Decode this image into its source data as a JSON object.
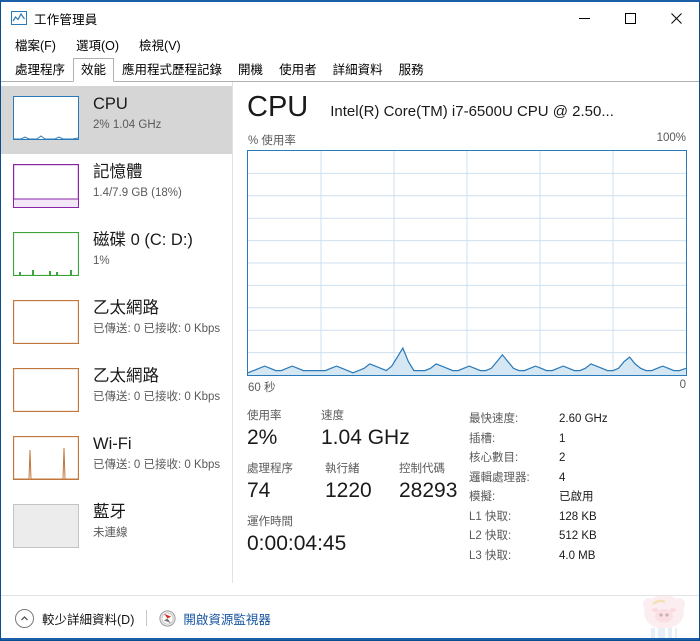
{
  "window": {
    "title": "工作管理員",
    "icon": "task-manager-icon",
    "minimize": "—",
    "maximize": "▢",
    "close": "✕"
  },
  "menu": [
    {
      "label": "檔案(F)",
      "name": "menu-file"
    },
    {
      "label": "選項(O)",
      "name": "menu-options"
    },
    {
      "label": "檢視(V)",
      "name": "menu-view"
    }
  ],
  "tabs": [
    {
      "label": "處理程序",
      "name": "tab-processes",
      "active": false
    },
    {
      "label": "效能",
      "name": "tab-performance",
      "active": true
    },
    {
      "label": "應用程式歷程記錄",
      "name": "tab-app-history",
      "active": false
    },
    {
      "label": "開機",
      "name": "tab-startup",
      "active": false
    },
    {
      "label": "使用者",
      "name": "tab-users",
      "active": false
    },
    {
      "label": "詳細資料",
      "name": "tab-details",
      "active": false
    },
    {
      "label": "服務",
      "name": "tab-services",
      "active": false
    }
  ],
  "sidebar": {
    "items": [
      {
        "name": "sidebar-item-cpu",
        "title": "CPU",
        "sub": "2%  1.04 GHz",
        "color": "#2a7ab9",
        "selected": true
      },
      {
        "name": "sidebar-item-memory",
        "title": "記憶體",
        "sub": "1.4/7.9 GB (18%)",
        "color": "#8a24a8",
        "selected": false
      },
      {
        "name": "sidebar-item-disk0",
        "title": "磁碟 0 (C: D:)",
        "sub": "1%",
        "color": "#3ba43b",
        "selected": false
      },
      {
        "name": "sidebar-item-ethernet1",
        "title": "乙太網路",
        "sub": "已傳送: 0 已接收: 0 Kbps",
        "color": "#c1763c",
        "selected": false
      },
      {
        "name": "sidebar-item-ethernet2",
        "title": "乙太網路",
        "sub": "已傳送: 0 已接收: 0 Kbps",
        "color": "#c1763c",
        "selected": false
      },
      {
        "name": "sidebar-item-wifi",
        "title": "Wi-Fi",
        "sub": "已傳送: 0 已接收: 0 Kbps",
        "color": "#c1763c",
        "selected": false
      },
      {
        "name": "sidebar-item-bluetooth",
        "title": "藍牙",
        "sub": "未連線",
        "color": "#b8b8b8",
        "selected": false
      }
    ]
  },
  "main": {
    "title": "CPU",
    "subtitle": "Intel(R) Core(TM) i7-6500U CPU @ 2.50...",
    "graph_caption_left": "% 使用率",
    "graph_caption_right": "100%",
    "axis_left": "60 秒",
    "axis_right": "0",
    "stats_left": [
      [
        {
          "name": "stat-utilization",
          "label": "使用率",
          "value": "2%"
        },
        {
          "name": "stat-speed",
          "label": "速度",
          "value": "1.04 GHz"
        }
      ],
      [
        {
          "name": "stat-processes",
          "label": "處理程序",
          "value": "74"
        },
        {
          "name": "stat-threads",
          "label": "執行緒",
          "value": "1220"
        },
        {
          "name": "stat-handles",
          "label": "控制代碼",
          "value": "28293"
        }
      ],
      [
        {
          "name": "stat-uptime",
          "label": "運作時間",
          "value": "0:00:04:45"
        }
      ]
    ],
    "stats_right": [
      {
        "name": "spec-max-speed",
        "key": "最快速度:",
        "val": "2.60 GHz"
      },
      {
        "name": "spec-sockets",
        "key": "插槽:",
        "val": "1"
      },
      {
        "name": "spec-cores",
        "key": "核心數目:",
        "val": "2"
      },
      {
        "name": "spec-logical",
        "key": "邏輯處理器:",
        "val": "4"
      },
      {
        "name": "spec-virtual",
        "key": "模擬:",
        "val": "已啟用"
      },
      {
        "name": "spec-l1-cache",
        "key": "L1 快取:",
        "val": "128 KB"
      },
      {
        "name": "spec-l2-cache",
        "key": "L2 快取:",
        "val": "512 KB"
      },
      {
        "name": "spec-l3-cache",
        "key": "L3 快取:",
        "val": "4.0 MB"
      }
    ]
  },
  "statusbar": {
    "fewer_details": "較少詳細資料(D)",
    "resource_monitor": "開啟資源監視器",
    "chevron_icon": "chevron-up-icon",
    "resmon_icon": "resource-monitor-icon"
  },
  "chart_data": {
    "type": "area",
    "title": "CPU 使用率",
    "xlabel": "60 秒",
    "ylabel": "% 使用率",
    "ylim": [
      0,
      100
    ],
    "xlim": [
      60,
      0
    ],
    "grid": true,
    "grid_cols": 6,
    "grid_rows": 10,
    "line_color": "#2a7ab9",
    "fill_color": "#cfe3f2",
    "values": [
      1,
      2,
      3,
      4,
      3,
      2,
      2,
      3,
      4,
      3,
      2,
      2,
      2,
      2,
      2,
      3,
      4,
      3,
      2,
      1,
      2,
      3,
      5,
      4,
      3,
      2,
      4,
      8,
      12,
      6,
      2,
      2,
      2,
      3,
      5,
      4,
      3,
      2,
      2,
      3,
      4,
      3,
      2,
      2,
      3,
      6,
      9,
      6,
      3,
      2,
      2,
      3,
      4,
      3,
      2,
      2,
      3,
      4,
      3,
      2,
      2,
      3,
      5,
      4,
      3,
      2,
      2,
      3,
      6,
      8,
      5,
      3,
      2,
      2,
      3,
      4,
      3,
      2,
      2,
      3
    ]
  }
}
